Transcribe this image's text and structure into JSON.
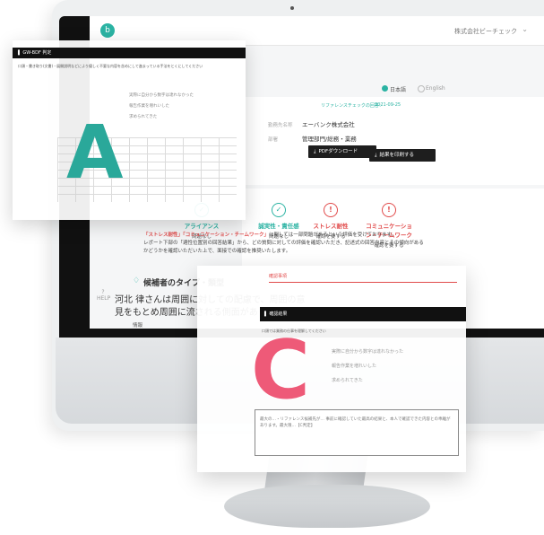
{
  "app": {
    "company_menu": "株式会社ビーチェック",
    "logo_letter": "b"
  },
  "language": {
    "options": [
      "日本語",
      "English"
    ],
    "selected": "日本語"
  },
  "reference": {
    "label": "リファレンスチェックの回答：",
    "date": "2021-09-25"
  },
  "candidate": {
    "company_label": "勤務先名称",
    "company_value": "エーバンク株式会社",
    "dept_label": "部署",
    "dept_value": "管理部門/総務・業務"
  },
  "actions": {
    "pdf_download": "PDFダウンロード",
    "print_results": "結果を印刷する"
  },
  "categories": [
    {
      "title": "アライアンス",
      "status": "問題なし",
      "color": "#2bb3a3",
      "icon": "check-icon"
    },
    {
      "title": "誠実性・責任感",
      "status": "問題なし",
      "color": "#2bb3a3",
      "icon": "check-icon"
    },
    {
      "title": "ストレス耐性",
      "status": "確認を要する",
      "color": "#e14b4b",
      "icon": "alert-icon"
    },
    {
      "title": "コミュニケーション・チームワーク",
      "status": "確認を要する",
      "color": "#e14b4b",
      "icon": "alert-icon"
    }
  ],
  "notes": {
    "highlight": "「ストレス耐性」「コミュニケーション・チームワーク」",
    "text1": "に関しては一部問題があるという評価を受けております。",
    "text2": "レポート下部の「適性位置別の回答結果」から、どの質問に対しての評価を確認いただき、記述式の回答内容とその傾向がある",
    "text3": "かどうかを確認いただいた上で、面接での確認を推奨いたします。"
  },
  "section": {
    "icon": "lightbulb-icon",
    "title": "候補者のタイプ・類型",
    "body": "河北 律さんは周囲に対しての配慮で、周囲の意見をもとめ周囲に流される側面があります。",
    "row_label": "情報"
  },
  "help": {
    "icon": "?",
    "label": "HELP"
  },
  "doc_a": {
    "header": "▌ GW-BDF 判定",
    "subtitle": "口頭・書き取り(文書)・展開説明などにより優しく不要な内容を含めにして進まっている手法をとくにしてください",
    "letter": "A",
    "options": [
      "実際に自分から数字は達れなかった",
      "報告作業を増れいした",
      "求められてきた"
    ]
  },
  "doc_c": {
    "header": "確認事項",
    "bar": "▌ 確認結果",
    "subtitle": "口頭では業務の仕事を理解してください",
    "letter": "C",
    "options": [
      "実際に自分から数字は達れなかった",
      "報告作業を増れいした",
      "求められてきた"
    ],
    "note": "最大の…・リファレンス候補先が… 事前に確認していた最高の結果と、本人で確認できた内容との乖離があります。最大限…【C判定】"
  }
}
